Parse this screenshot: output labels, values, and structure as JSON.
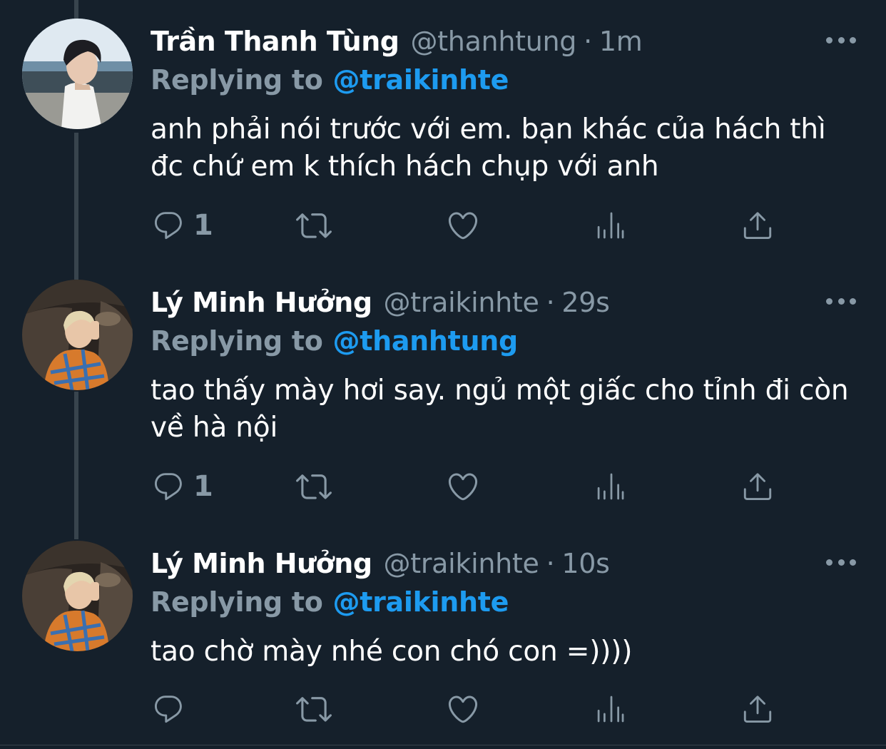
{
  "colors": {
    "background": "#15202b",
    "text_primary": "#ffffff",
    "text_secondary": "#8899a6",
    "accent": "#1d9bf0",
    "thread_line": "#38444d"
  },
  "tweets": [
    {
      "display_name": "Trần Thanh Tùng",
      "handle": "@thanhtung",
      "separator": "·",
      "time": "1m",
      "reply_prefix": "Replying to",
      "reply_to": "@traikinhte",
      "text": "anh phải nói trước với em. bạn khác của hách thì đc chứ em k thích hách chụp với anh",
      "reply_count": "1",
      "retweet_count": "",
      "like_count": "",
      "avatar_icon": "avatar-photo-boy-seaside"
    },
    {
      "display_name": "Lý Minh Hưởng",
      "handle": "@traikinhte",
      "separator": "·",
      "time": "29s",
      "reply_prefix": "Replying to",
      "reply_to": "@thanhtung",
      "text": "tao thấy mày hơi say. ngủ một giấc cho tỉnh đi còn về hà nội",
      "reply_count": "1",
      "retweet_count": "",
      "like_count": "",
      "avatar_icon": "avatar-photo-car-selfie"
    },
    {
      "display_name": "Lý Minh Hưởng",
      "handle": "@traikinhte",
      "separator": "·",
      "time": "10s",
      "reply_prefix": "Replying to",
      "reply_to": "@traikinhte",
      "text": "tao chờ mày nhé con chó con =))))",
      "reply_count": "",
      "retweet_count": "",
      "like_count": "",
      "avatar_icon": "avatar-photo-car-selfie"
    }
  ],
  "icons": {
    "reply": "reply-icon",
    "retweet": "retweet-icon",
    "like": "heart-icon",
    "analytics": "analytics-icon",
    "share": "share-icon",
    "more": "more-icon"
  }
}
